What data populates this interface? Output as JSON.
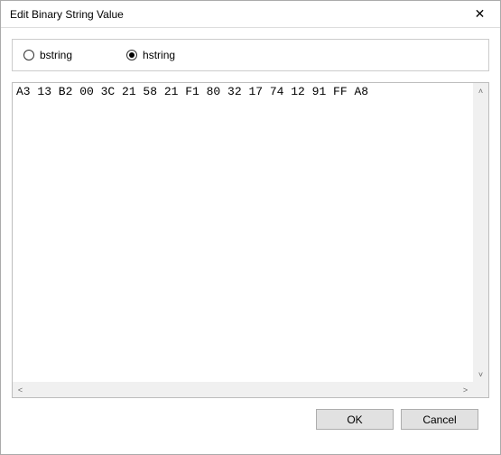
{
  "title": "Edit Binary String Value",
  "format_group": {
    "options": {
      "bstring": {
        "label": "bstring",
        "selected": false
      },
      "hstring": {
        "label": "hstring",
        "selected": true
      }
    }
  },
  "value": "A3 13 B2 00 3C 21 58 21 F1 80 32 17 74 12 91 FF A8",
  "buttons": {
    "ok": "OK",
    "cancel": "Cancel"
  }
}
